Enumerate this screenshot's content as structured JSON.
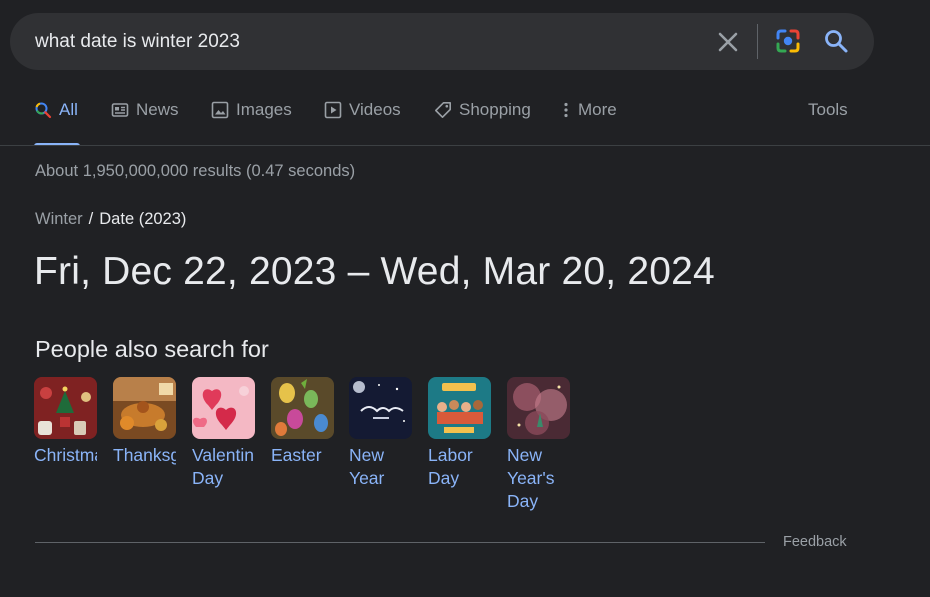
{
  "search": {
    "query": "what date is winter 2023"
  },
  "tabs": [
    {
      "label": "All",
      "icon": "search-icon"
    },
    {
      "label": "News",
      "icon": "news-icon"
    },
    {
      "label": "Images",
      "icon": "image-icon"
    },
    {
      "label": "Videos",
      "icon": "video-icon"
    },
    {
      "label": "Shopping",
      "icon": "tag-icon"
    },
    {
      "label": "More",
      "icon": "more-vertical-icon"
    }
  ],
  "tools_label": "Tools",
  "result_stats": "About 1,950,000,000 results (0.47 seconds)",
  "breadcrumb": {
    "parent": "Winter",
    "separator": "/",
    "current": "Date (2023)"
  },
  "answer": "Fri, Dec 22, 2023 – Wed, Mar 20, 2024",
  "people_also_search": {
    "title": "People also search for",
    "items": [
      {
        "label": "Christmas Day"
      },
      {
        "label": "Thanksgiving"
      },
      {
        "label": "Valentin Day"
      },
      {
        "label": "Easter"
      },
      {
        "label": "New Year"
      },
      {
        "label": "Labor Day"
      },
      {
        "label": "New Year's Day"
      }
    ]
  },
  "feedback_label": "Feedback",
  "colors": {
    "background": "#202124",
    "searchbar": "#303134",
    "link": "#8ab4f8",
    "muted": "#9aa0a6",
    "text": "#e8eaed"
  }
}
